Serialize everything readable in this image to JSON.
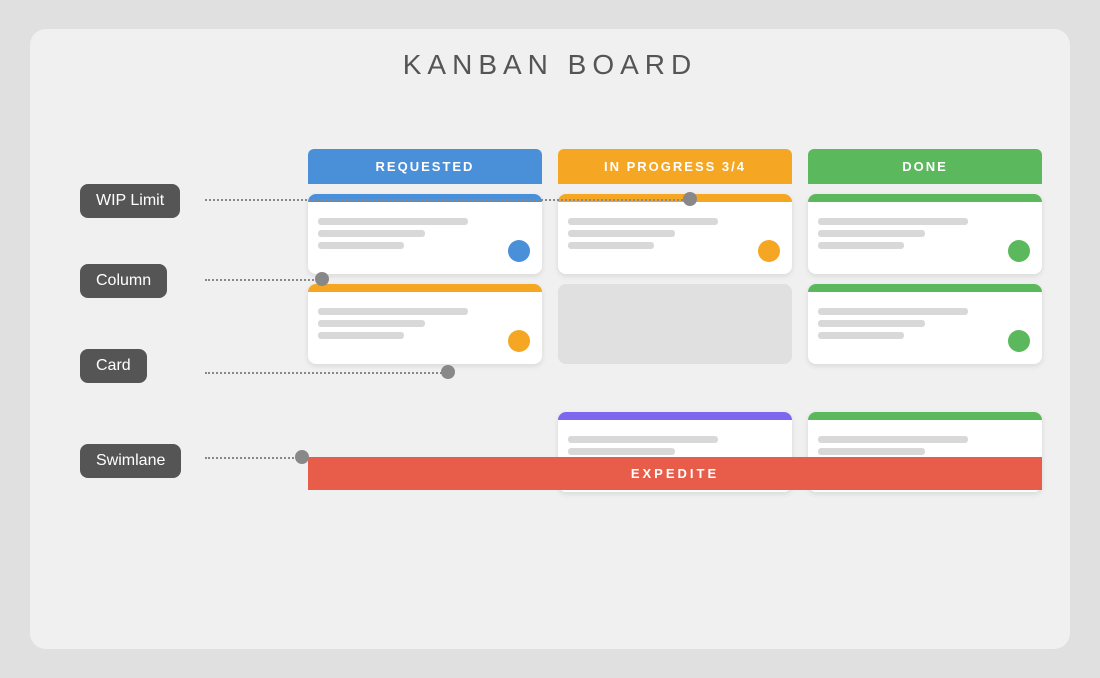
{
  "board": {
    "title": "KANBAN BOARD",
    "labels": {
      "wip_limit": "WIP Limit",
      "column": "Column",
      "card": "Card",
      "swimlane": "Swimlane"
    },
    "columns": [
      {
        "id": "requested",
        "header": "REQUESTED",
        "color": "#4a90d9"
      },
      {
        "id": "inprogress",
        "header": "IN PROGRESS 3/4",
        "color": "#f5a623"
      },
      {
        "id": "done",
        "header": "DONE",
        "color": "#5cb85c"
      }
    ],
    "swimlane": {
      "label": "EXPEDITE",
      "color": "#e85d4a"
    }
  }
}
